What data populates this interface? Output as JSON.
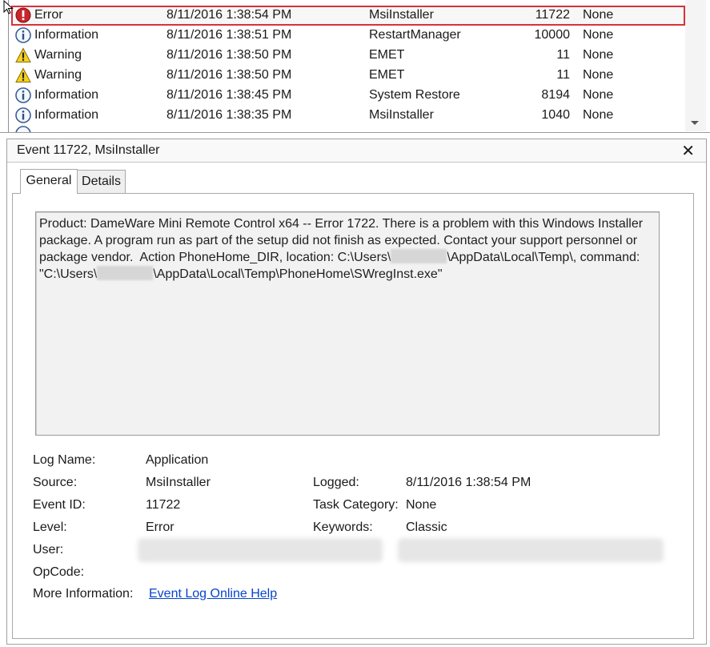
{
  "event_list": {
    "rows": [
      {
        "level": "Error",
        "date": "8/11/2016 1:38:54 PM",
        "source": "MsiInstaller",
        "event_id": "11722",
        "task": "None",
        "icon": "error-icon"
      },
      {
        "level": "Information",
        "date": "8/11/2016 1:38:51 PM",
        "source": "RestartManager",
        "event_id": "10000",
        "task": "None",
        "icon": "information-icon"
      },
      {
        "level": "Warning",
        "date": "8/11/2016 1:38:50 PM",
        "source": "EMET",
        "event_id": "11",
        "task": "None",
        "icon": "warning-icon"
      },
      {
        "level": "Warning",
        "date": "8/11/2016 1:38:50 PM",
        "source": "EMET",
        "event_id": "11",
        "task": "None",
        "icon": "warning-icon"
      },
      {
        "level": "Information",
        "date": "8/11/2016 1:38:45 PM",
        "source": "System Restore",
        "event_id": "8194",
        "task": "None",
        "icon": "information-icon"
      },
      {
        "level": "Information",
        "date": "8/11/2016 1:38:35 PM",
        "source": "MsiInstaller",
        "event_id": "1040",
        "task": "None",
        "icon": "information-icon"
      }
    ],
    "selected_index": 0,
    "highlight_color": "#d8323a"
  },
  "detail": {
    "title": "Event 11722, MsiInstaller",
    "tabs": {
      "general": "General",
      "details": "Details"
    },
    "message": {
      "part1": "Product: DameWare Mini Remote Control x64 -- Error 1722. There is a problem with this Windows Installer package. A program run as part of the setup did not finish as expected. Contact your support personnel or package vendor.  Action PhoneHome_DIR, location: C:\\Users\\",
      "part2": "\\AppData\\Local\\Temp\\, command: \"C:\\Users\\",
      "part3": "\\AppData\\Local\\Temp\\PhoneHome\\SWregInst.exe\""
    },
    "fields": {
      "log_name_label": "Log Name:",
      "log_name": "Application",
      "source_label": "Source:",
      "source": "MsiInstaller",
      "logged_label": "Logged:",
      "logged": "8/11/2016 1:38:54 PM",
      "event_id_label": "Event ID:",
      "event_id": "11722",
      "task_category_label": "Task Category:",
      "task_category": "None",
      "level_label": "Level:",
      "level": "Error",
      "keywords_label": "Keywords:",
      "keywords": "Classic",
      "user_label": "User:",
      "computer_label": "",
      "opcode_label": "OpCode:",
      "more_info_label": "More Information:",
      "more_info_link": "Event Log Online Help"
    }
  }
}
